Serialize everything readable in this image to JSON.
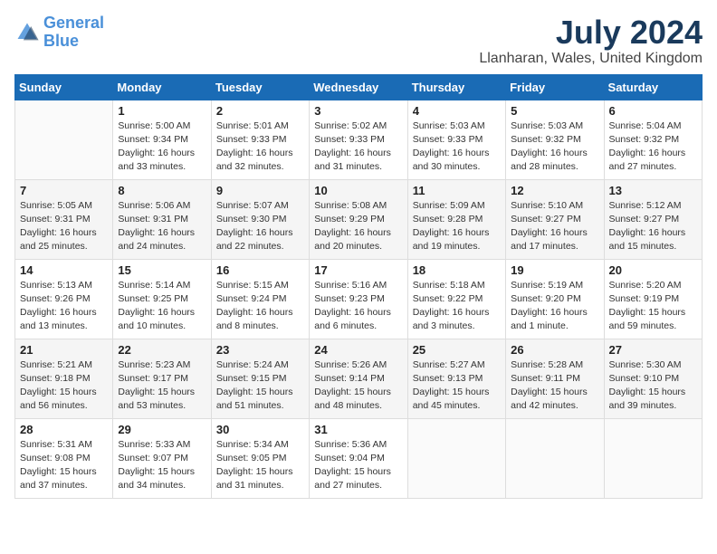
{
  "logo": {
    "line1": "General",
    "line2": "Blue"
  },
  "title": "July 2024",
  "location": "Llanharan, Wales, United Kingdom",
  "days_of_week": [
    "Sunday",
    "Monday",
    "Tuesday",
    "Wednesday",
    "Thursday",
    "Friday",
    "Saturday"
  ],
  "weeks": [
    [
      {
        "day": "",
        "info": ""
      },
      {
        "day": "1",
        "info": "Sunrise: 5:00 AM\nSunset: 9:34 PM\nDaylight: 16 hours\nand 33 minutes."
      },
      {
        "day": "2",
        "info": "Sunrise: 5:01 AM\nSunset: 9:33 PM\nDaylight: 16 hours\nand 32 minutes."
      },
      {
        "day": "3",
        "info": "Sunrise: 5:02 AM\nSunset: 9:33 PM\nDaylight: 16 hours\nand 31 minutes."
      },
      {
        "day": "4",
        "info": "Sunrise: 5:03 AM\nSunset: 9:33 PM\nDaylight: 16 hours\nand 30 minutes."
      },
      {
        "day": "5",
        "info": "Sunrise: 5:03 AM\nSunset: 9:32 PM\nDaylight: 16 hours\nand 28 minutes."
      },
      {
        "day": "6",
        "info": "Sunrise: 5:04 AM\nSunset: 9:32 PM\nDaylight: 16 hours\nand 27 minutes."
      }
    ],
    [
      {
        "day": "7",
        "info": "Sunrise: 5:05 AM\nSunset: 9:31 PM\nDaylight: 16 hours\nand 25 minutes."
      },
      {
        "day": "8",
        "info": "Sunrise: 5:06 AM\nSunset: 9:31 PM\nDaylight: 16 hours\nand 24 minutes."
      },
      {
        "day": "9",
        "info": "Sunrise: 5:07 AM\nSunset: 9:30 PM\nDaylight: 16 hours\nand 22 minutes."
      },
      {
        "day": "10",
        "info": "Sunrise: 5:08 AM\nSunset: 9:29 PM\nDaylight: 16 hours\nand 20 minutes."
      },
      {
        "day": "11",
        "info": "Sunrise: 5:09 AM\nSunset: 9:28 PM\nDaylight: 16 hours\nand 19 minutes."
      },
      {
        "day": "12",
        "info": "Sunrise: 5:10 AM\nSunset: 9:27 PM\nDaylight: 16 hours\nand 17 minutes."
      },
      {
        "day": "13",
        "info": "Sunrise: 5:12 AM\nSunset: 9:27 PM\nDaylight: 16 hours\nand 15 minutes."
      }
    ],
    [
      {
        "day": "14",
        "info": "Sunrise: 5:13 AM\nSunset: 9:26 PM\nDaylight: 16 hours\nand 13 minutes."
      },
      {
        "day": "15",
        "info": "Sunrise: 5:14 AM\nSunset: 9:25 PM\nDaylight: 16 hours\nand 10 minutes."
      },
      {
        "day": "16",
        "info": "Sunrise: 5:15 AM\nSunset: 9:24 PM\nDaylight: 16 hours\nand 8 minutes."
      },
      {
        "day": "17",
        "info": "Sunrise: 5:16 AM\nSunset: 9:23 PM\nDaylight: 16 hours\nand 6 minutes."
      },
      {
        "day": "18",
        "info": "Sunrise: 5:18 AM\nSunset: 9:22 PM\nDaylight: 16 hours\nand 3 minutes."
      },
      {
        "day": "19",
        "info": "Sunrise: 5:19 AM\nSunset: 9:20 PM\nDaylight: 16 hours\nand 1 minute."
      },
      {
        "day": "20",
        "info": "Sunrise: 5:20 AM\nSunset: 9:19 PM\nDaylight: 15 hours\nand 59 minutes."
      }
    ],
    [
      {
        "day": "21",
        "info": "Sunrise: 5:21 AM\nSunset: 9:18 PM\nDaylight: 15 hours\nand 56 minutes."
      },
      {
        "day": "22",
        "info": "Sunrise: 5:23 AM\nSunset: 9:17 PM\nDaylight: 15 hours\nand 53 minutes."
      },
      {
        "day": "23",
        "info": "Sunrise: 5:24 AM\nSunset: 9:15 PM\nDaylight: 15 hours\nand 51 minutes."
      },
      {
        "day": "24",
        "info": "Sunrise: 5:26 AM\nSunset: 9:14 PM\nDaylight: 15 hours\nand 48 minutes."
      },
      {
        "day": "25",
        "info": "Sunrise: 5:27 AM\nSunset: 9:13 PM\nDaylight: 15 hours\nand 45 minutes."
      },
      {
        "day": "26",
        "info": "Sunrise: 5:28 AM\nSunset: 9:11 PM\nDaylight: 15 hours\nand 42 minutes."
      },
      {
        "day": "27",
        "info": "Sunrise: 5:30 AM\nSunset: 9:10 PM\nDaylight: 15 hours\nand 39 minutes."
      }
    ],
    [
      {
        "day": "28",
        "info": "Sunrise: 5:31 AM\nSunset: 9:08 PM\nDaylight: 15 hours\nand 37 minutes."
      },
      {
        "day": "29",
        "info": "Sunrise: 5:33 AM\nSunset: 9:07 PM\nDaylight: 15 hours\nand 34 minutes."
      },
      {
        "day": "30",
        "info": "Sunrise: 5:34 AM\nSunset: 9:05 PM\nDaylight: 15 hours\nand 31 minutes."
      },
      {
        "day": "31",
        "info": "Sunrise: 5:36 AM\nSunset: 9:04 PM\nDaylight: 15 hours\nand 27 minutes."
      },
      {
        "day": "",
        "info": ""
      },
      {
        "day": "",
        "info": ""
      },
      {
        "day": "",
        "info": ""
      }
    ]
  ]
}
